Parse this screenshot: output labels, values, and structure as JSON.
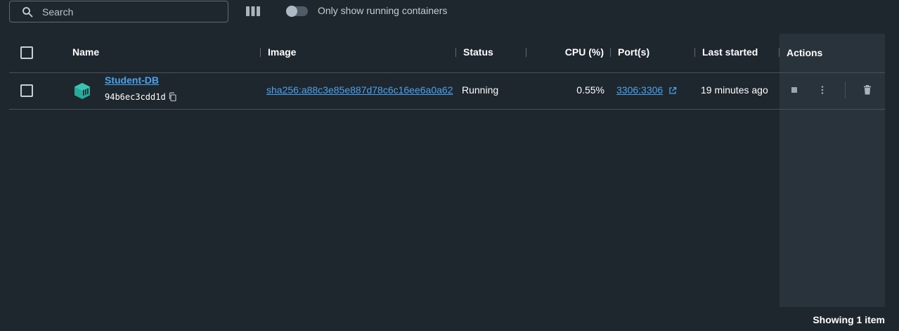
{
  "toolbar": {
    "search_placeholder": "Search",
    "toggle_label": "Only show running containers",
    "toggle_on": false
  },
  "table": {
    "headers": {
      "name": "Name",
      "image": "Image",
      "status": "Status",
      "cpu": "CPU (%)",
      "ports": "Port(s)",
      "last_started": "Last started",
      "actions": "Actions"
    },
    "rows": [
      {
        "name": "Student-DB",
        "container_id": "94b6ec3cdd1d",
        "image": "sha256:a88c3e85e887d78c6c16ee6a0a62",
        "status": "Running",
        "cpu": "0.55%",
        "ports": "3306:3306",
        "last_started": "19 minutes ago"
      }
    ]
  },
  "footer": {
    "count_label": "Showing 1 item"
  },
  "icons": {
    "search": "search-icon",
    "columns": "columns-icon",
    "container": "container-icon",
    "copy": "copy-icon",
    "external_link": "external-link-icon",
    "stop": "stop-icon",
    "more": "more-vertical-icon",
    "delete": "trash-icon"
  },
  "colors": {
    "background": "#1f272e",
    "actions_panel": "#29333b",
    "link": "#4ba3f0",
    "container_icon": "#28a99a"
  }
}
